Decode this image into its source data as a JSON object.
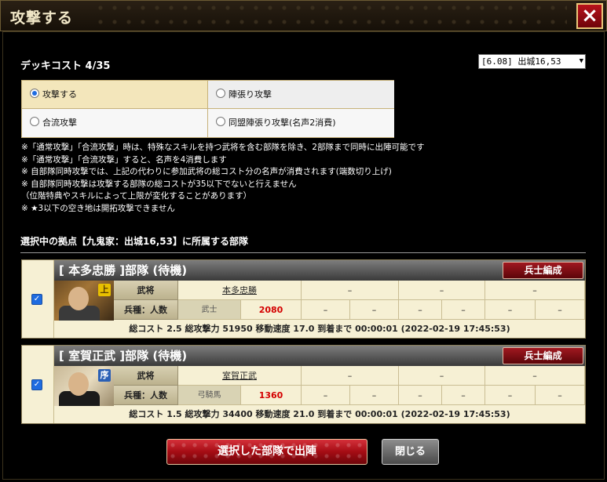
{
  "window": {
    "title": "攻撃する",
    "close_icon": "×"
  },
  "deck_cost": "デッキコスト 4/35",
  "base_select": {
    "selected": "[6.08] 出城16,53"
  },
  "attack_options": [
    {
      "label": "攻撃する",
      "selected": true
    },
    {
      "label": "陣張り攻撃",
      "selected": false
    },
    {
      "label": "合流攻撃",
      "selected": false
    },
    {
      "label": "同盟陣張り攻撃(名声2消費)",
      "selected": false
    }
  ],
  "notes": [
    "※「通常攻撃」「合流攻撃」時は、特殊なスキルを持つ武将を含む部隊を除き、2部隊まで同時に出陣可能です",
    "※「通常攻撃」「合流攻撃」すると、名声を4消費します",
    "※ 自部隊同時攻撃では、上記の代わりに参加武将の総コスト分の名声が消費されます(端数切り上げ)",
    "※ 自部隊同時攻撃は攻撃する部隊の総コストが35以下でないと行えません",
    "（位階特典やスキルによって上限が変化することがあります）",
    "※ ★3以下の空き地は開拓攻撃できません"
  ],
  "section_title": "選択中の拠点【九鬼家：出城16,53】に所属する部隊",
  "units": [
    {
      "name": "[ 本多忠勝 ]部隊 (待機)",
      "troop_button": "兵士編成",
      "rank": "上",
      "general_label": "武将",
      "troop_label": "兵種：人数",
      "general": "本多忠勝",
      "kind": "武士",
      "count": "2080",
      "empty": "–",
      "summary": "総コスト 2.5 総攻撃力 51950 移動速度 17.0 到着まで 00:00:01 (2022-02-19 17:45:53)"
    },
    {
      "name": "[ 室賀正武 ]部隊 (待機)",
      "troop_button": "兵士編成",
      "rank": "序",
      "general_label": "武将",
      "troop_label": "兵種：人数",
      "general": "室賀正武",
      "kind": "弓騎馬",
      "count": "1360",
      "empty": "–",
      "summary": "総コスト 1.5 総攻撃力 34400 移動速度 21.0 到着まで 00:00:01 (2022-02-19 17:45:53)"
    }
  ],
  "buttons": {
    "sortie": "選択した部隊で出陣",
    "close": "閉じる"
  }
}
